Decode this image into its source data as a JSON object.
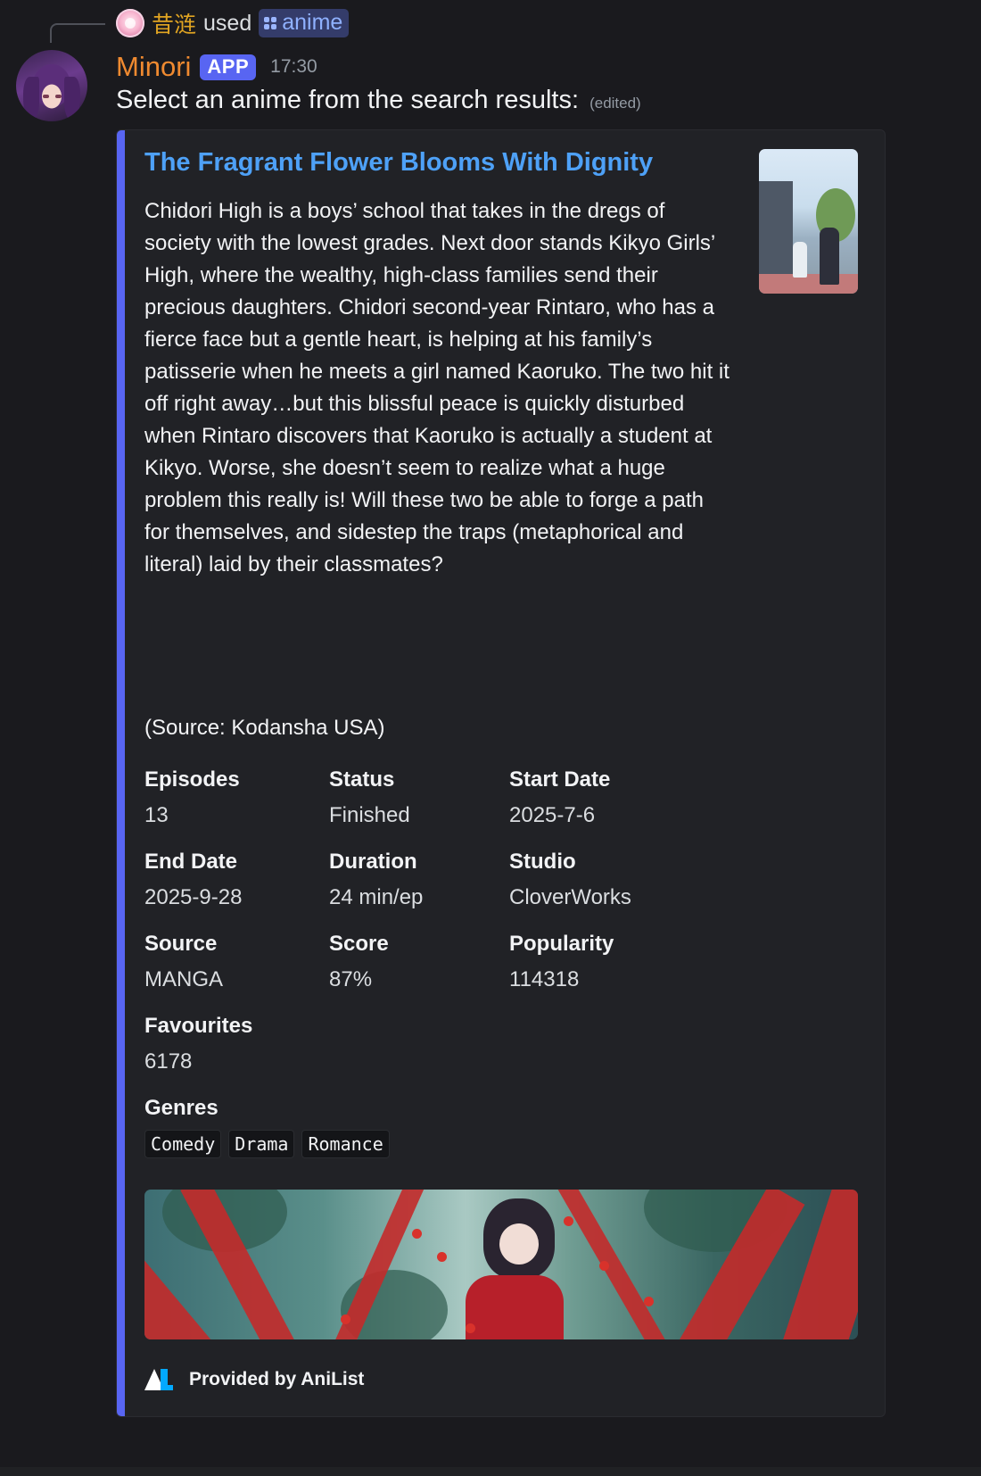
{
  "interaction": {
    "user": "昔涟",
    "verb": "used",
    "command": "anime"
  },
  "message": {
    "author": "Minori",
    "badge": "APP",
    "time": "17:30",
    "content": "Select an anime from the search results:",
    "edited": "(edited)"
  },
  "embed": {
    "accent_color": "#5865f2",
    "title": "The Fragrant Flower Blooms With Dignity",
    "description": "Chidori High is a boys’ school that takes in the dregs of society with the lowest grades. Next door stands Kikyo Girls’ High, where the wealthy, high-class families send their precious daughters. Chidori second-year Rintaro, who has a fierce face but a gentle heart, is helping at his family’s patisserie when he meets a girl named Kaoruko. The two hit it off right away…but this blissful peace is quickly disturbed when Rintaro discovers that Kaoruko is actually a student at Kikyo. Worse, she doesn’t seem to realize what a huge problem this really is! Will these two be able to forge a path for themselves, and sidestep the traps (metaphorical and literal) laid by their classmates?",
    "source": "(Source: Kodansha USA)",
    "fields": [
      {
        "name": "Episodes",
        "value": "13"
      },
      {
        "name": "Status",
        "value": "Finished"
      },
      {
        "name": "Start Date",
        "value": "2025-7-6"
      },
      {
        "name": "End Date",
        "value": "2025-9-28"
      },
      {
        "name": "Duration",
        "value": "24 min/ep"
      },
      {
        "name": "Studio",
        "value": "CloverWorks"
      },
      {
        "name": "Source",
        "value": "MANGA"
      },
      {
        "name": "Score",
        "value": "87%"
      },
      {
        "name": "Popularity",
        "value": "114318"
      },
      {
        "name": "Favourites",
        "value": "6178"
      }
    ],
    "genres_label": "Genres",
    "genres": [
      "Comedy",
      "Drama",
      "Romance"
    ],
    "footer": "Provided by AniList"
  }
}
